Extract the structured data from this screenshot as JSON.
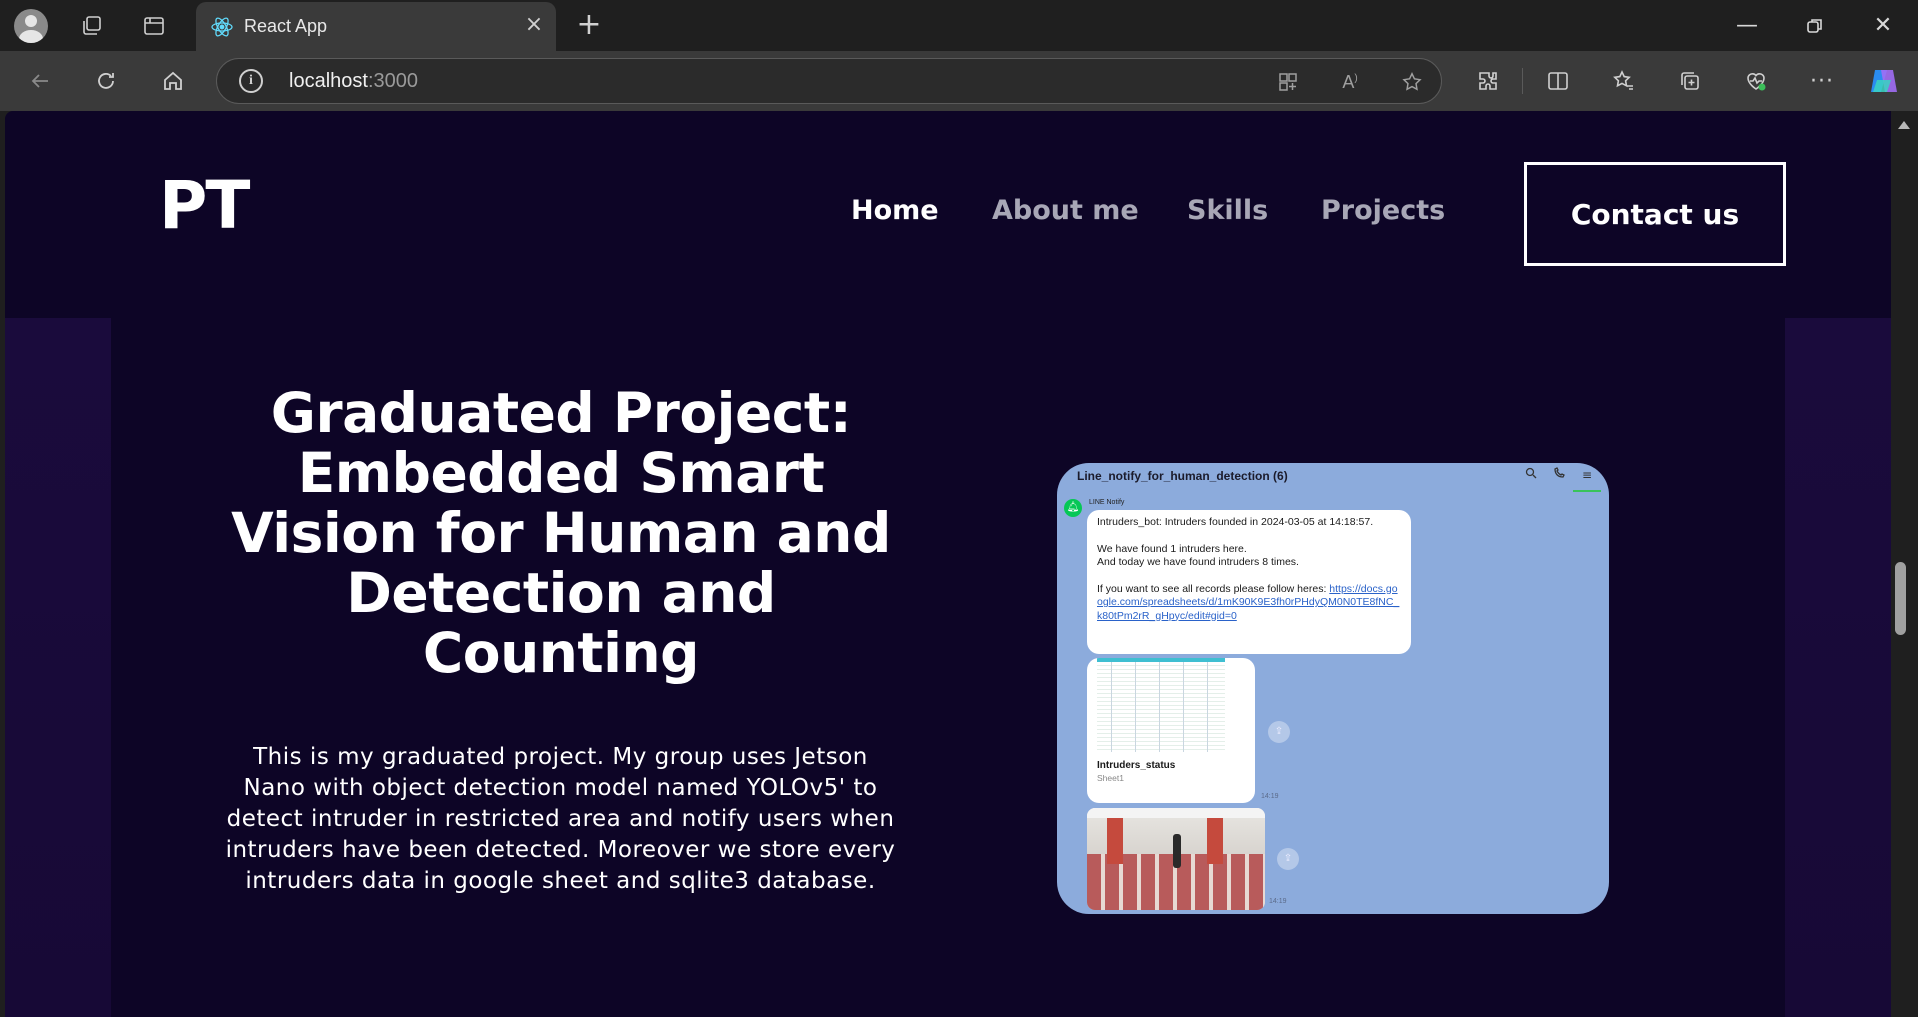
{
  "browser": {
    "tab_title": "React App",
    "address_host": "localhost",
    "address_port": ":3000"
  },
  "site": {
    "logo": "PT",
    "nav": [
      "Home",
      "About me",
      "Skills",
      "Projects"
    ],
    "contact_label": "Contact us"
  },
  "project": {
    "title": "Graduated Project: Embedded Smart Vision for Human and Detection and Counting",
    "description": "This is my graduated project. My group uses Jetson Nano with object detection model named YOLOv5' to detect intruder in restricted area and notify users when intruders have been detected. Moreover we store every intruders data in google sheet and sqlite3 database."
  },
  "chat": {
    "header": "Line_notify_for_human_detection (6)",
    "sender": "LINE Notify",
    "message_line1": "Intruders_bot: Intruders founded in 2024-03-05 at 14:18:57.",
    "message_line2": "We have found 1 intruders here.",
    "message_line3": "And today we have found intruders 8 times.",
    "message_line4": "If you want to see all records please follow heres:",
    "message_link": "https://docs.google.com/spreadsheets/d/1mK90K9E3fh0rPHdyQM0N0TE8fNC_k80tPm2rR_gHpyc/edit#gid=0",
    "sheet_title": "Intruders_status",
    "sheet_sub": "Sheet1",
    "time1": "14:19",
    "time2": "14:19"
  },
  "colors": {
    "page_bg": "#0d0526",
    "side_panel": "#1a0b3c",
    "chat_bg": "#8cabdc",
    "line_green": "#06c755"
  },
  "icons": {
    "tab_favicon": "react-icon",
    "address_info": "info-icon"
  }
}
